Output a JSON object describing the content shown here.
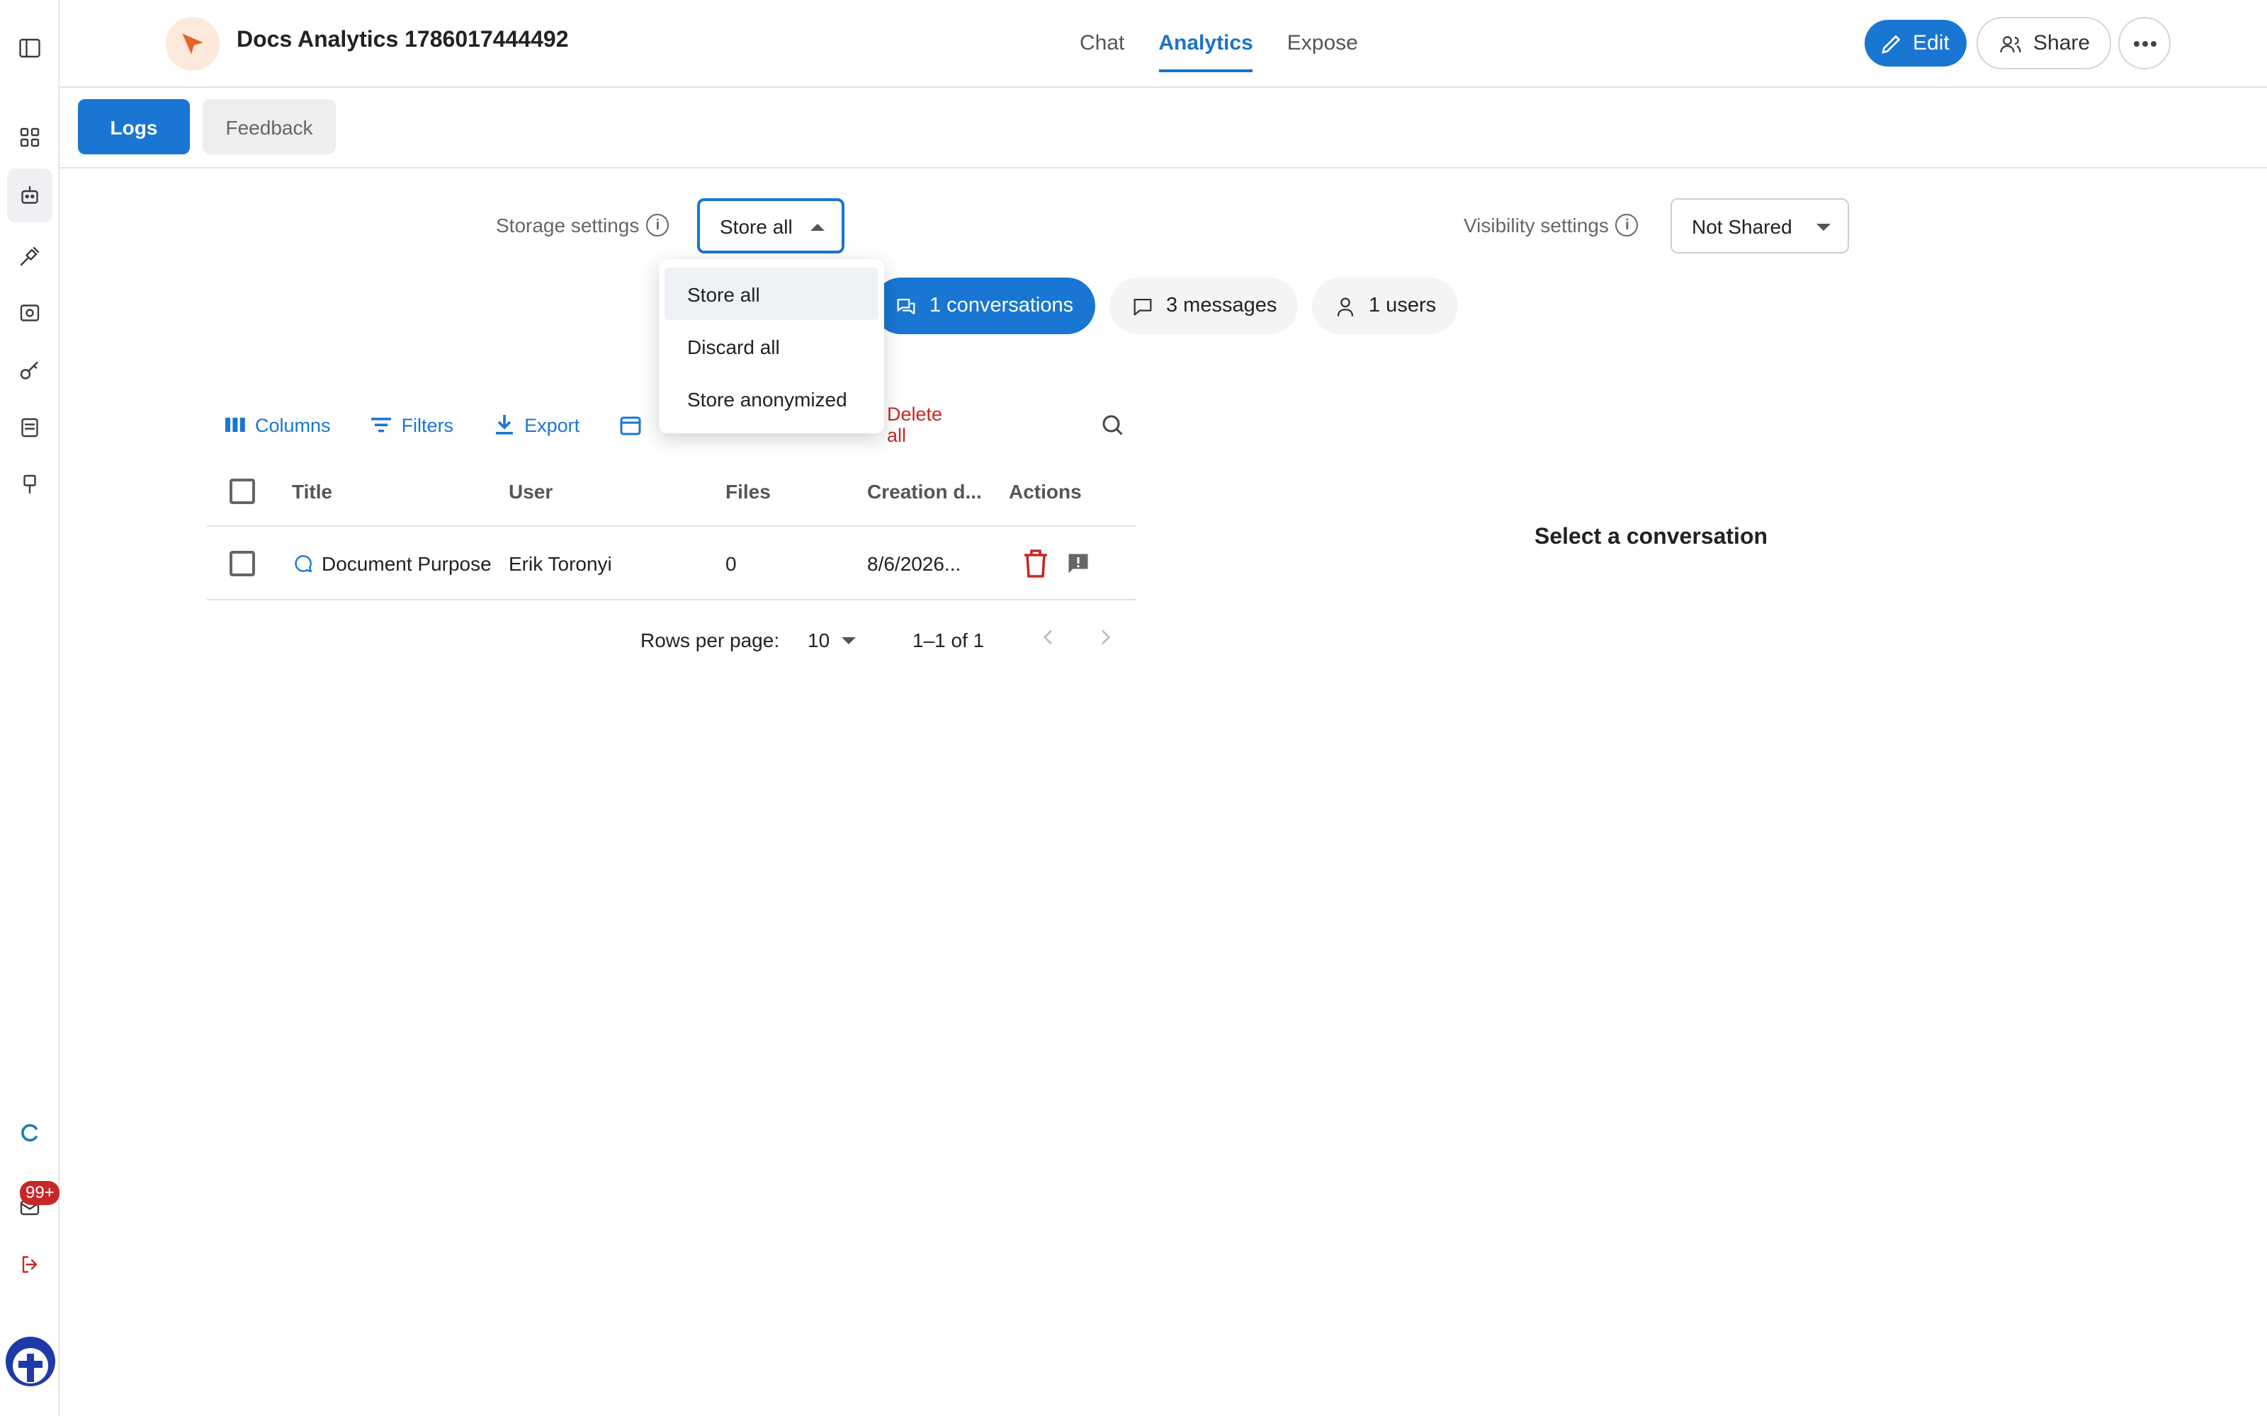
{
  "header": {
    "app_title": "Docs Analytics 1786017444492",
    "nav": [
      "Chat",
      "Analytics",
      "Expose"
    ],
    "active_nav": "Analytics",
    "edit_label": "Edit",
    "share_label": "Share"
  },
  "subtabs": {
    "logs": "Logs",
    "feedback": "Feedback"
  },
  "settings": {
    "storage_label": "Storage settings",
    "storage_value": "Store all",
    "storage_options": [
      "Store all",
      "Discard all",
      "Store anonymized"
    ],
    "visibility_label": "Visibility settings",
    "visibility_value": "Not Shared"
  },
  "stats": {
    "conversations": "1 conversations",
    "messages": "3 messages",
    "users": "1 users"
  },
  "toolbar": {
    "columns": "Columns",
    "filters": "Filters",
    "export": "Export",
    "delete_all": "Delete all"
  },
  "table": {
    "headers": [
      "Title",
      "User",
      "Files",
      "Creation d...",
      "Actions"
    ],
    "rows": [
      {
        "title": "Document Purpose",
        "user": "Erik Toronyi",
        "files": "0",
        "created": "8/6/2026..."
      }
    ]
  },
  "pagination": {
    "rows_per_page_label": "Rows per page:",
    "rows_per_page": "10",
    "range": "1–1 of 1"
  },
  "detail": {
    "empty_text": "Select a conversation"
  },
  "notifications_badge": "99+",
  "colors": {
    "primary": "#1976d2",
    "danger": "#c62828",
    "logo_accent": "#e8622c"
  }
}
